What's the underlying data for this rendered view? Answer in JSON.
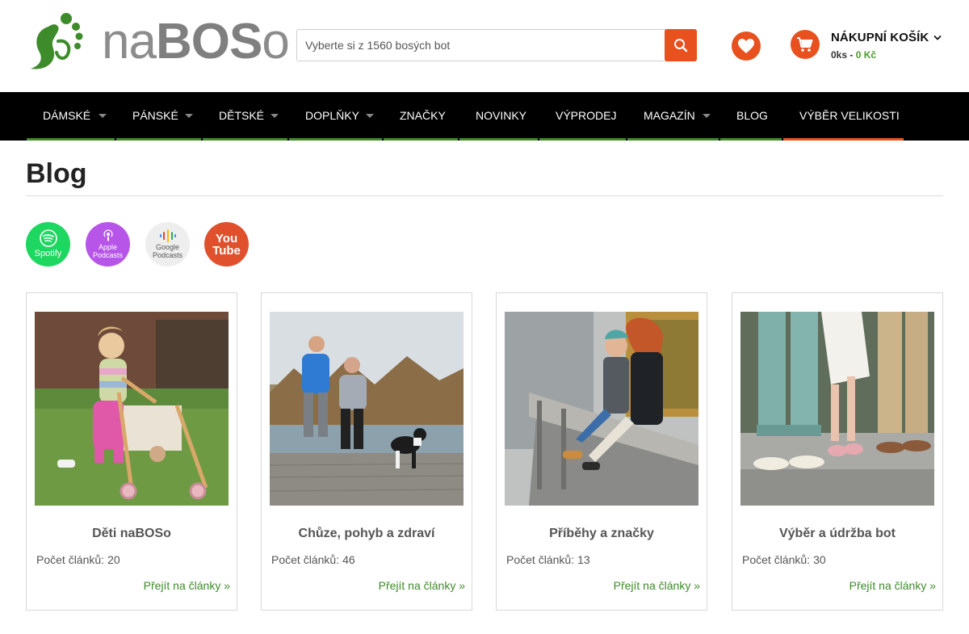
{
  "brand": {
    "logo_text_thin": "na",
    "logo_text_bold": "BOS",
    "logo_text_tail": "o",
    "accent_green": "#3d8b2a",
    "accent_orange": "#e8501e",
    "footprint_icon": "footprint-icon"
  },
  "search": {
    "placeholder": "Vyberte si z 1560 bosých bot",
    "button_icon": "magnifier-icon"
  },
  "wishlist": {
    "icon": "heart-icon"
  },
  "cart": {
    "label": "NÁKUPNÍ KOŠÍK",
    "count": "0ks",
    "separator": " - ",
    "total": "0 Kč",
    "icon": "cart-icon"
  },
  "nav": {
    "items": [
      {
        "label": "DÁMSKÉ",
        "has_dropdown": true
      },
      {
        "label": "PÁNSKÉ",
        "has_dropdown": true
      },
      {
        "label": "DĚTSKÉ",
        "has_dropdown": true
      },
      {
        "label": "DOPLŇKY",
        "has_dropdown": true
      },
      {
        "label": "ZNAČKY",
        "has_dropdown": false
      },
      {
        "label": "NOVINKY",
        "has_dropdown": false
      },
      {
        "label": "VÝPRODEJ",
        "has_dropdown": false
      },
      {
        "label": "MAGAZÍN",
        "has_dropdown": true
      },
      {
        "label": "BLOG",
        "has_dropdown": false
      },
      {
        "label": "VÝBĚR VELIKOSTI",
        "has_dropdown": false
      }
    ]
  },
  "page": {
    "title": "Blog"
  },
  "podcasts": [
    {
      "name": "Spotify",
      "icon": "spotify-icon"
    },
    {
      "name": "Apple",
      "name2": "Podcasts",
      "icon": "apple-podcasts-icon"
    },
    {
      "name": "Google",
      "name2": "Podcasts",
      "icon": "google-podcasts-icon"
    },
    {
      "name": "You",
      "name2": "Tube",
      "icon": "youtube-icon"
    }
  ],
  "categories": [
    {
      "title": "Děti naBOSo",
      "count_label": "Počet článků:",
      "count": "20",
      "link": "Přejít na články »"
    },
    {
      "title": "Chůze, pohyb a zdraví",
      "count_label": "Počet článků:",
      "count": "46",
      "link": "Přejít na články »"
    },
    {
      "title": "Příběhy a značky",
      "count_label": "Počet článků:",
      "count": "13",
      "link": "Přejít na články »"
    },
    {
      "title": "Výběr a údržba bot",
      "count_label": "Počet článků:",
      "count": "30",
      "link": "Přejít na články »"
    }
  ]
}
